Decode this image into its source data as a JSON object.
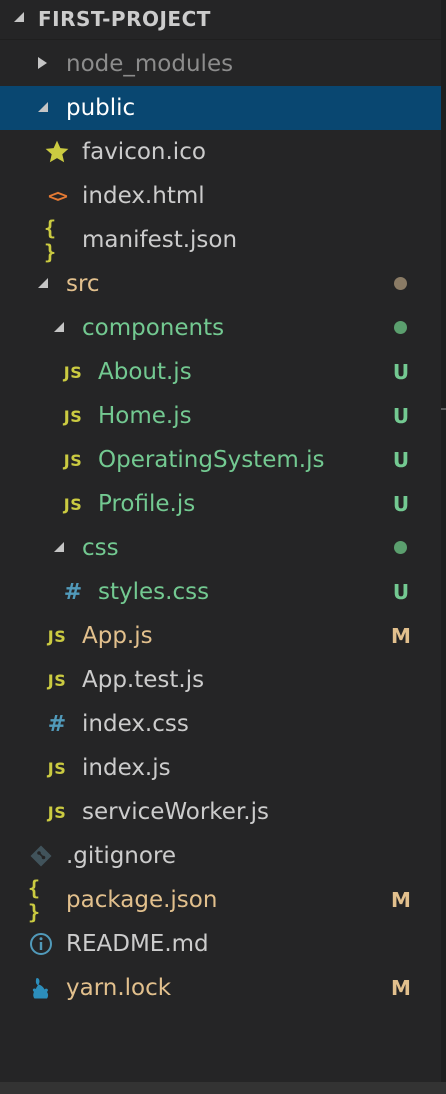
{
  "explorer": {
    "project_title": "FIRST-PROJECT"
  },
  "colors": {
    "sidebar_background": "#252526",
    "selection": "#094771",
    "untracked": "#73c991",
    "modified": "#e2c08d",
    "js_icon": "#cbcb41",
    "css_icon": "#519aba",
    "html_icon": "#e37933"
  },
  "tree": [
    {
      "name": "node_modules",
      "kind": "folder",
      "expanded": false,
      "depth": 1,
      "icon": "chevron-right-icon",
      "text_style": "ignored",
      "git_status": ""
    },
    {
      "name": "public",
      "kind": "folder",
      "expanded": true,
      "depth": 1,
      "icon": "chevron-down-icon",
      "text_style": "selected",
      "git_status": ""
    },
    {
      "name": "favicon.ico",
      "kind": "file",
      "depth": 2,
      "icon": "star-icon",
      "glyph": "★",
      "text_style": "normal",
      "git_status": ""
    },
    {
      "name": "index.html",
      "kind": "file",
      "depth": 2,
      "icon": "html-icon",
      "glyph": "<>",
      "text_style": "normal",
      "git_status": ""
    },
    {
      "name": "manifest.json",
      "kind": "file",
      "depth": 2,
      "icon": "json-icon",
      "glyph": "{ }",
      "text_style": "normal",
      "git_status": ""
    },
    {
      "name": "src",
      "kind": "folder",
      "expanded": true,
      "depth": 1,
      "icon": "chevron-down-icon",
      "text_style": "modified",
      "git_status": "dot-modified"
    },
    {
      "name": "components",
      "kind": "folder",
      "expanded": true,
      "depth": 2,
      "icon": "chevron-down-icon",
      "text_style": "untracked",
      "git_status": "dot-untracked"
    },
    {
      "name": "About.js",
      "kind": "file",
      "depth": 3,
      "icon": "javascript-icon",
      "glyph": "JS",
      "text_style": "untracked",
      "git_status": "U"
    },
    {
      "name": "Home.js",
      "kind": "file",
      "depth": 3,
      "icon": "javascript-icon",
      "glyph": "JS",
      "text_style": "untracked",
      "git_status": "U"
    },
    {
      "name": "OperatingSystem.js",
      "kind": "file",
      "depth": 3,
      "icon": "javascript-icon",
      "glyph": "JS",
      "text_style": "untracked",
      "git_status": "U"
    },
    {
      "name": "Profile.js",
      "kind": "file",
      "depth": 3,
      "icon": "javascript-icon",
      "glyph": "JS",
      "text_style": "untracked",
      "git_status": "U"
    },
    {
      "name": "css",
      "kind": "folder",
      "expanded": true,
      "depth": 2,
      "icon": "chevron-down-icon",
      "text_style": "untracked",
      "git_status": "dot-untracked"
    },
    {
      "name": "styles.css",
      "kind": "file",
      "depth": 3,
      "icon": "css-icon",
      "glyph": "#",
      "text_style": "untracked",
      "git_status": "U"
    },
    {
      "name": "App.js",
      "kind": "file",
      "depth": 2,
      "icon": "javascript-icon",
      "glyph": "JS",
      "text_style": "modified",
      "git_status": "M"
    },
    {
      "name": "App.test.js",
      "kind": "file",
      "depth": 2,
      "icon": "javascript-icon",
      "glyph": "JS",
      "text_style": "normal",
      "git_status": ""
    },
    {
      "name": "index.css",
      "kind": "file",
      "depth": 2,
      "icon": "css-icon",
      "glyph": "#",
      "text_style": "normal",
      "git_status": ""
    },
    {
      "name": "index.js",
      "kind": "file",
      "depth": 2,
      "icon": "javascript-icon",
      "glyph": "JS",
      "text_style": "normal",
      "git_status": ""
    },
    {
      "name": "serviceWorker.js",
      "kind": "file",
      "depth": 2,
      "icon": "javascript-icon",
      "glyph": "JS",
      "text_style": "normal",
      "git_status": ""
    },
    {
      "name": ".gitignore",
      "kind": "file",
      "depth": 1,
      "icon": "git-icon",
      "glyph": "",
      "text_style": "normal",
      "git_status": ""
    },
    {
      "name": "package.json",
      "kind": "file",
      "depth": 1,
      "icon": "json-icon",
      "glyph": "{ }",
      "text_style": "modified",
      "git_status": "M"
    },
    {
      "name": "README.md",
      "kind": "file",
      "depth": 1,
      "icon": "info-icon",
      "glyph": "",
      "text_style": "normal",
      "git_status": ""
    },
    {
      "name": "yarn.lock",
      "kind": "file",
      "depth": 1,
      "icon": "yarn-icon",
      "glyph": "",
      "text_style": "modified",
      "git_status": "M"
    }
  ]
}
